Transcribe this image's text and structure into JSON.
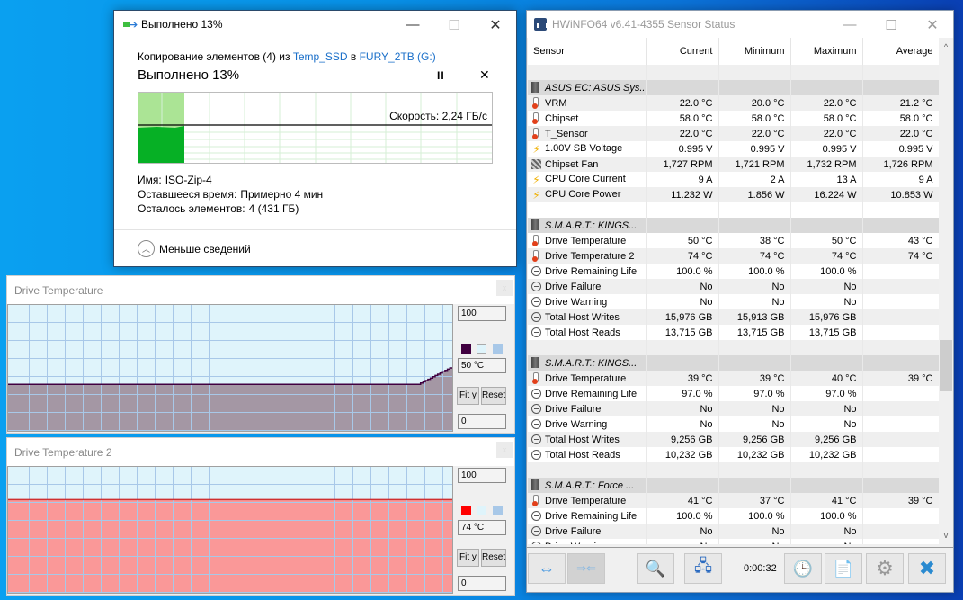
{
  "copy_dialog": {
    "title": "Выполнено 13%",
    "window_buttons": {
      "minimize": "—",
      "maximize": "☐",
      "close": "✕"
    },
    "description": {
      "prefix": "Копирование элементов (4) из ",
      "source": "Temp_SSD",
      "middle": " в ",
      "destination": "FURY_2TB (G:)"
    },
    "heading": "Выполнено 13%",
    "progress_percent": 13,
    "pause_label": "II",
    "cancel_label": "✕",
    "speed_label": "Скорость: 2,24 ГБ/с",
    "info": [
      {
        "key": "Имя:",
        "value": "ISO-Zip-4"
      },
      {
        "key": "Оставшееся время:",
        "value": "Примерно 4 мин"
      },
      {
        "key": "Осталось элементов:",
        "value": "4 (431 ГБ)"
      }
    ],
    "less_details_label": "Меньше сведений",
    "colors": {
      "progress_fill": "#abe495",
      "speed_fill": "#06b025",
      "link": "#1a6fc9"
    }
  },
  "graph_windows": [
    {
      "title": "Drive Temperature",
      "close_label": "x",
      "max_label": "100",
      "current_label": "50 °C",
      "min_label": "0",
      "fit_label": "Fit y",
      "reset_label": "Reset",
      "line_color": "#400040",
      "fill_color": "#a497a4",
      "bg_color": "#dff4fb",
      "grid_color": "#a8c8e8",
      "ymax": 100,
      "samples": [
        37,
        37,
        37,
        37,
        37,
        37,
        37,
        37,
        37,
        37,
        37,
        37,
        37,
        37,
        37,
        37,
        37,
        37,
        37,
        37,
        37,
        37,
        37,
        37,
        37,
        37,
        37,
        37,
        37,
        37,
        37,
        37,
        37,
        37,
        37,
        37,
        37,
        37,
        37,
        37,
        37,
        37,
        37,
        37,
        37,
        37,
        37,
        37,
        37,
        37,
        37,
        37,
        37,
        37,
        37,
        37,
        37,
        37,
        37,
        37,
        37,
        37,
        37,
        37,
        37,
        37,
        37,
        37,
        37,
        37,
        37,
        37,
        37,
        37,
        37,
        37,
        37,
        37,
        37,
        37,
        37,
        37,
        37,
        37,
        37,
        37,
        37,
        37,
        37,
        37,
        37,
        37,
        37,
        37,
        37,
        37,
        37,
        37,
        37,
        37,
        37,
        37,
        37,
        37,
        37,
        37,
        37,
        37,
        37,
        37,
        37,
        37,
        37,
        37,
        37,
        37,
        37,
        37,
        37,
        37,
        37,
        37,
        37,
        37,
        37,
        37,
        37,
        37,
        37,
        37,
        37,
        37,
        37,
        37,
        37,
        37,
        37,
        37,
        37,
        37,
        37,
        37,
        37,
        37,
        37,
        37,
        37,
        37,
        37,
        37,
        37,
        37,
        37,
        37,
        37,
        37,
        37,
        37,
        37,
        37,
        37,
        37,
        37,
        37,
        37,
        37,
        37,
        37,
        37,
        38,
        39,
        40,
        41,
        42,
        43,
        44,
        45,
        46,
        47,
        48,
        49,
        50
      ]
    },
    {
      "title": "Drive Temperature 2",
      "close_label": "x",
      "max_label": "100",
      "current_label": "74 °C",
      "min_label": "0",
      "fit_label": "Fit y",
      "reset_label": "Reset",
      "line_color": "#d03030",
      "fill_color": "#fa9898",
      "bg_color": "#dff4fb",
      "grid_color": "#a8c8e8",
      "swatch_color": "#ff0000",
      "ymax": 100,
      "samples": [
        74,
        74,
        74,
        74,
        74,
        74,
        74,
        74,
        74,
        74,
        74,
        74,
        74,
        74,
        74,
        74,
        74,
        74,
        74,
        74
      ]
    }
  ],
  "hwinfo": {
    "title": "HWiNFO64 v6.41-4355 Sensor Status",
    "window_buttons": {
      "minimize": "—",
      "maximize": "☐",
      "close": "✕"
    },
    "columns": [
      "Sensor",
      "Current",
      "Minimum",
      "Maximum",
      "Average"
    ],
    "rows": [
      {
        "type": "blank"
      },
      {
        "type": "group",
        "icon": "chip",
        "name": "ASUS EC: ASUS Sys..."
      },
      {
        "icon": "temp",
        "name": "VRM",
        "current": "22.0 °C",
        "min": "20.0 °C",
        "max": "22.0 °C",
        "avg": "21.2 °C"
      },
      {
        "icon": "temp",
        "name": "Chipset",
        "current": "58.0 °C",
        "min": "58.0 °C",
        "max": "58.0 °C",
        "avg": "58.0 °C"
      },
      {
        "icon": "temp",
        "name": "T_Sensor",
        "current": "22.0 °C",
        "min": "22.0 °C",
        "max": "22.0 °C",
        "avg": "22.0 °C"
      },
      {
        "icon": "volt",
        "name": "1.00V SB Voltage",
        "current": "0.995 V",
        "min": "0.995 V",
        "max": "0.995 V",
        "avg": "0.995 V"
      },
      {
        "icon": "fan",
        "name": "Chipset Fan",
        "current": "1,727 RPM",
        "min": "1,721 RPM",
        "max": "1,732 RPM",
        "avg": "1,726 RPM"
      },
      {
        "icon": "volt",
        "name": "CPU Core Current",
        "current": "9 A",
        "min": "2 A",
        "max": "13 A",
        "avg": "9 A"
      },
      {
        "icon": "volt",
        "name": "CPU Core Power",
        "current": "11.232 W",
        "min": "1.856 W",
        "max": "16.224 W",
        "avg": "10.853 W"
      },
      {
        "type": "blank"
      },
      {
        "type": "group",
        "icon": "chip",
        "name": "S.M.A.R.T.: KINGS..."
      },
      {
        "icon": "temp",
        "name": "Drive Temperature",
        "current": "50 °C",
        "min": "38 °C",
        "max": "50 °C",
        "avg": "43 °C"
      },
      {
        "icon": "temp",
        "name": "Drive Temperature 2",
        "current": "74 °C",
        "min": "74 °C",
        "max": "74 °C",
        "avg": "74 °C"
      },
      {
        "icon": "clock",
        "name": "Drive Remaining Life",
        "current": "100.0 %",
        "min": "100.0 %",
        "max": "100.0 %",
        "avg": ""
      },
      {
        "icon": "clock",
        "name": "Drive Failure",
        "current": "No",
        "min": "No",
        "max": "No",
        "avg": ""
      },
      {
        "icon": "clock",
        "name": "Drive Warning",
        "current": "No",
        "min": "No",
        "max": "No",
        "avg": ""
      },
      {
        "icon": "clock",
        "name": "Total Host Writes",
        "current": "15,976 GB",
        "min": "15,913 GB",
        "max": "15,976 GB",
        "avg": ""
      },
      {
        "icon": "clock",
        "name": "Total Host Reads",
        "current": "13,715 GB",
        "min": "13,715 GB",
        "max": "13,715 GB",
        "avg": ""
      },
      {
        "type": "blank"
      },
      {
        "type": "group",
        "icon": "chip",
        "name": "S.M.A.R.T.: KINGS..."
      },
      {
        "icon": "temp",
        "name": "Drive Temperature",
        "current": "39 °C",
        "min": "39 °C",
        "max": "40 °C",
        "avg": "39 °C"
      },
      {
        "icon": "clock",
        "name": "Drive Remaining Life",
        "current": "97.0 %",
        "min": "97.0 %",
        "max": "97.0 %",
        "avg": ""
      },
      {
        "icon": "clock",
        "name": "Drive Failure",
        "current": "No",
        "min": "No",
        "max": "No",
        "avg": ""
      },
      {
        "icon": "clock",
        "name": "Drive Warning",
        "current": "No",
        "min": "No",
        "max": "No",
        "avg": ""
      },
      {
        "icon": "clock",
        "name": "Total Host Writes",
        "current": "9,256 GB",
        "min": "9,256 GB",
        "max": "9,256 GB",
        "avg": ""
      },
      {
        "icon": "clock",
        "name": "Total Host Reads",
        "current": "10,232 GB",
        "min": "10,232 GB",
        "max": "10,232 GB",
        "avg": ""
      },
      {
        "type": "blank"
      },
      {
        "type": "group",
        "icon": "chip",
        "name": "S.M.A.R.T.: Force ..."
      },
      {
        "icon": "temp",
        "name": "Drive Temperature",
        "current": "41 °C",
        "min": "37 °C",
        "max": "41 °C",
        "avg": "39 °C"
      },
      {
        "icon": "clock",
        "name": "Drive Remaining Life",
        "current": "100.0 %",
        "min": "100.0 %",
        "max": "100.0 %",
        "avg": ""
      },
      {
        "icon": "clock",
        "name": "Drive Failure",
        "current": "No",
        "min": "No",
        "max": "No",
        "avg": ""
      },
      {
        "icon": "clock",
        "name": "Drive Warning",
        "current": "No",
        "min": "No",
        "max": "No",
        "avg": ""
      }
    ],
    "scroll_up": "^",
    "scroll_down": "v",
    "toolbar": {
      "timer": "0:00:32",
      "buttons": [
        {
          "name": "expand-columns",
          "glyph": "⇔"
        },
        {
          "name": "collapse-columns",
          "glyph": "⇒⇐",
          "disabled": true
        },
        {
          "name": "sensor-search",
          "glyph": "🔍"
        },
        {
          "name": "network",
          "glyph": "🖧"
        },
        {
          "name": "reset-clock",
          "glyph": "🕒"
        },
        {
          "name": "logging",
          "glyph": "📄"
        },
        {
          "name": "settings",
          "glyph": "⚙"
        },
        {
          "name": "close",
          "glyph": "✖"
        }
      ]
    }
  }
}
